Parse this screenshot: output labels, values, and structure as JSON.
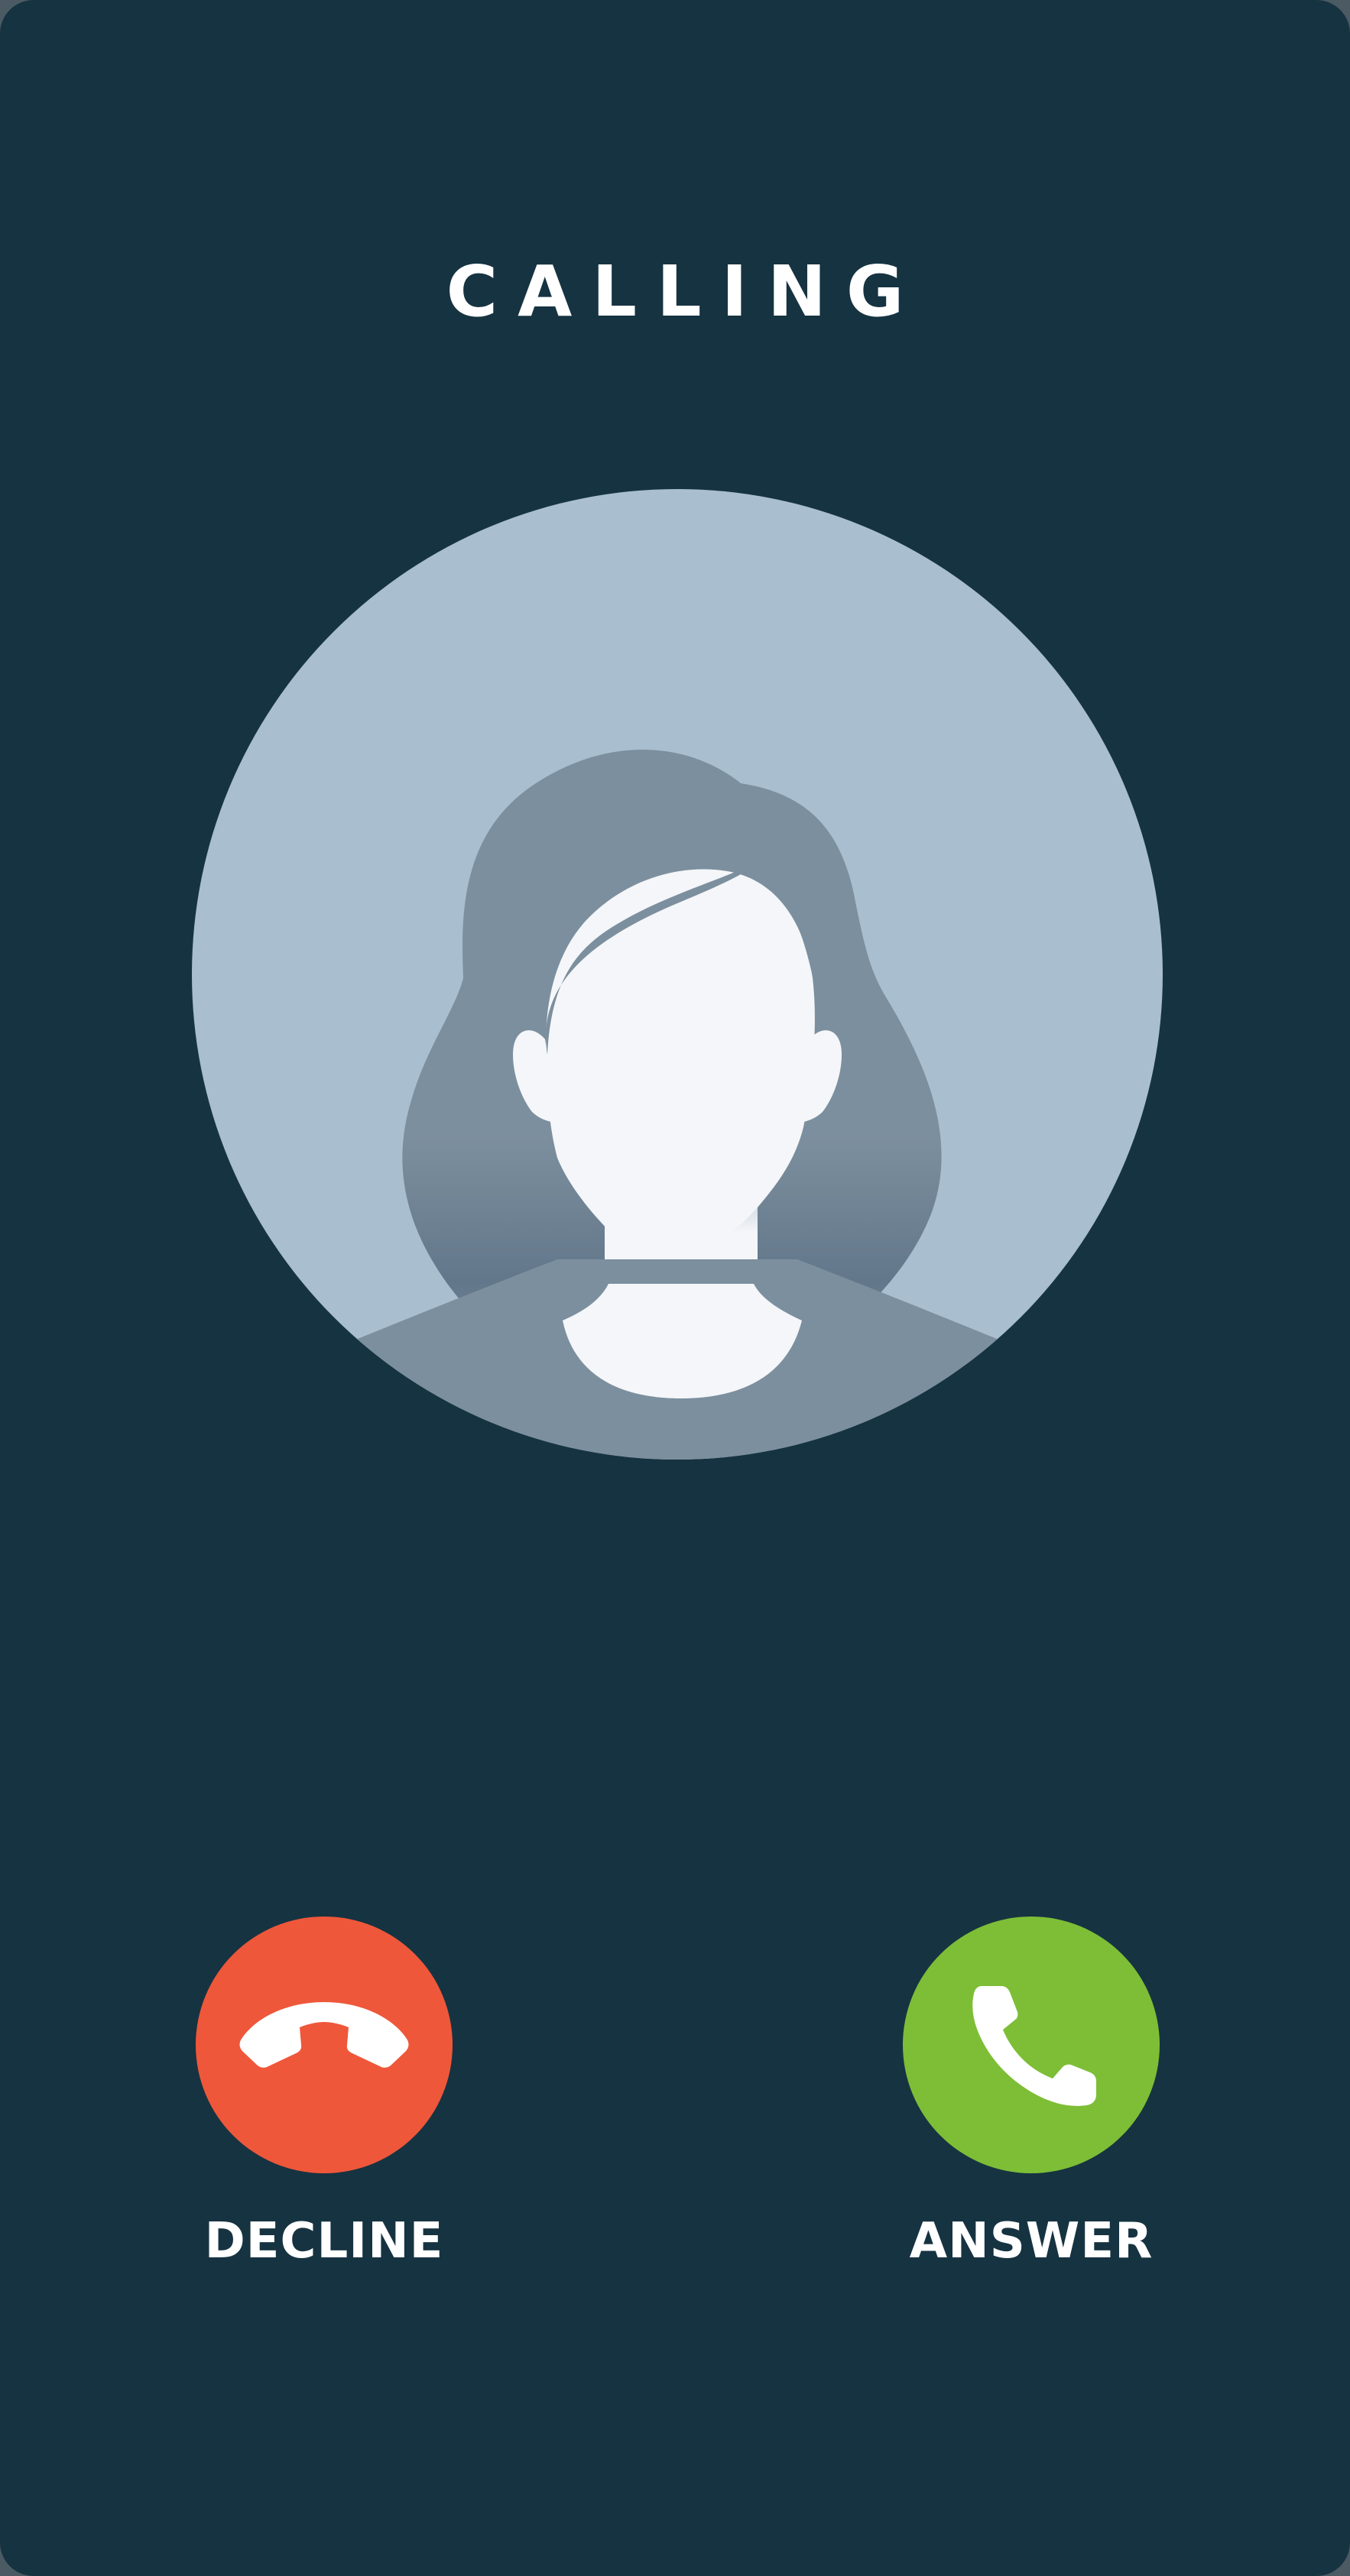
{
  "call": {
    "status": "CALLING"
  },
  "actions": {
    "decline": {
      "label": "DECLINE",
      "icon": "phone-hangup-icon",
      "color": "#ef573a"
    },
    "answer": {
      "label": "ANSWER",
      "icon": "phone-icon",
      "color": "#7dbe36"
    }
  },
  "theme": {
    "background": "#163341",
    "avatar_background": "#a9bece",
    "avatar_figure": "#7c8f9e",
    "avatar_skin": "#f4f6f9",
    "text": "#ffffff"
  }
}
